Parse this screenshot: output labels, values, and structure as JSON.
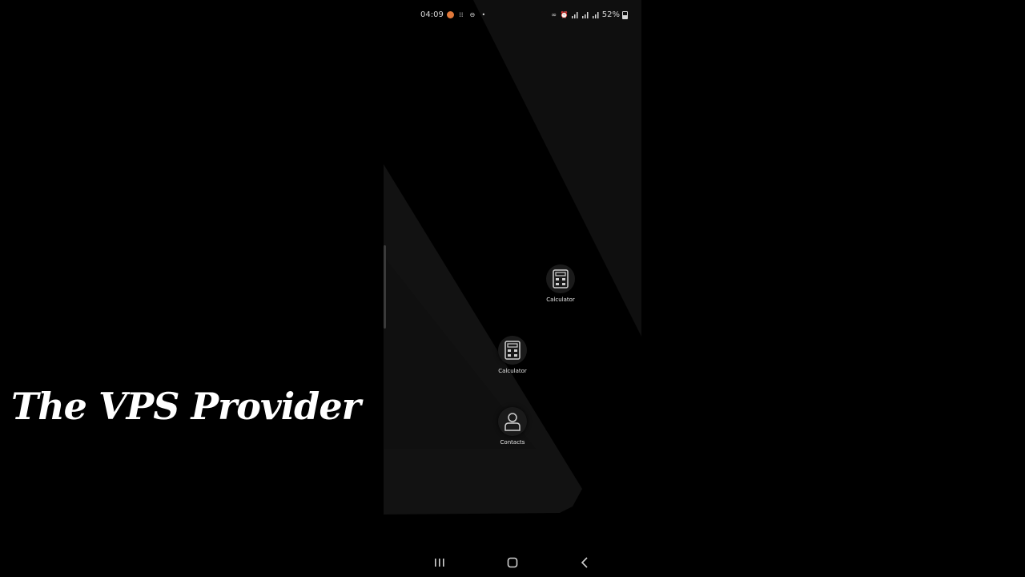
{
  "status_bar": {
    "time": "04:09",
    "battery_percent": "52%",
    "icons_left": [
      "notification-app-icon",
      "grid-dots-icon",
      "do-not-disturb-icon",
      "dot-icon"
    ],
    "icons_right": [
      "link-icon",
      "alarm-icon",
      "signal-icon",
      "4g-signal-icon",
      "signal-icon-2",
      "battery-icon"
    ]
  },
  "home_screen": {
    "apps": [
      {
        "label": "Calculator",
        "icon": "calculator-icon"
      },
      {
        "label": "Calculator",
        "icon": "calculator-icon"
      },
      {
        "label": "Contacts",
        "icon": "contacts-icon"
      }
    ]
  },
  "navigation_bar": {
    "buttons": [
      "recent-apps",
      "home",
      "back"
    ]
  },
  "watermark": {
    "text": "The VPS Provider"
  },
  "colors": {
    "background": "#000000",
    "wallpaper_light": "#141414",
    "text": "#e6e6e6",
    "status_accent": "#e0783a"
  }
}
